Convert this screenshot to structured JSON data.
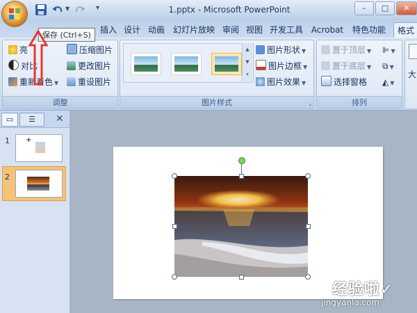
{
  "titlebar": {
    "title": "1.pptx - Microsoft PowerPoint",
    "minimize": "–",
    "close": "✕"
  },
  "tooltip": {
    "text": "保存 (Ctrl+S)"
  },
  "tabs": [
    {
      "label": "插入"
    },
    {
      "label": "设计"
    },
    {
      "label": "动画"
    },
    {
      "label": "幻灯片放映"
    },
    {
      "label": "审阅"
    },
    {
      "label": "视图"
    },
    {
      "label": "开发工具"
    },
    {
      "label": "Acrobat"
    },
    {
      "label": "特色功能"
    },
    {
      "label": "格式"
    }
  ],
  "ribbon": {
    "adjust": {
      "label": "调整",
      "brightness": "亮",
      "contrast": "对比",
      "recolor": "重新着色",
      "compress": "压缩图片",
      "change": "更改图片",
      "reset": "重设图片"
    },
    "picture_styles": {
      "label": "图片样式",
      "shape": "图片形状",
      "border": "图片边框",
      "effects": "图片效果"
    },
    "arrange": {
      "label": "排列",
      "bring_front": "置于顶层",
      "send_back": "置于底层",
      "selection_pane": "选择窗格"
    },
    "size": {
      "label": "大"
    }
  },
  "panel": {
    "slides": [
      {
        "number": "1"
      },
      {
        "number": "2"
      }
    ]
  },
  "watermark": {
    "line1": "经验啦✓",
    "line2": "jingyanla.com"
  },
  "colors": {
    "accent": "#e5392f",
    "ribbon": "#dee8f5",
    "selected_slide": "#f5c27a"
  }
}
